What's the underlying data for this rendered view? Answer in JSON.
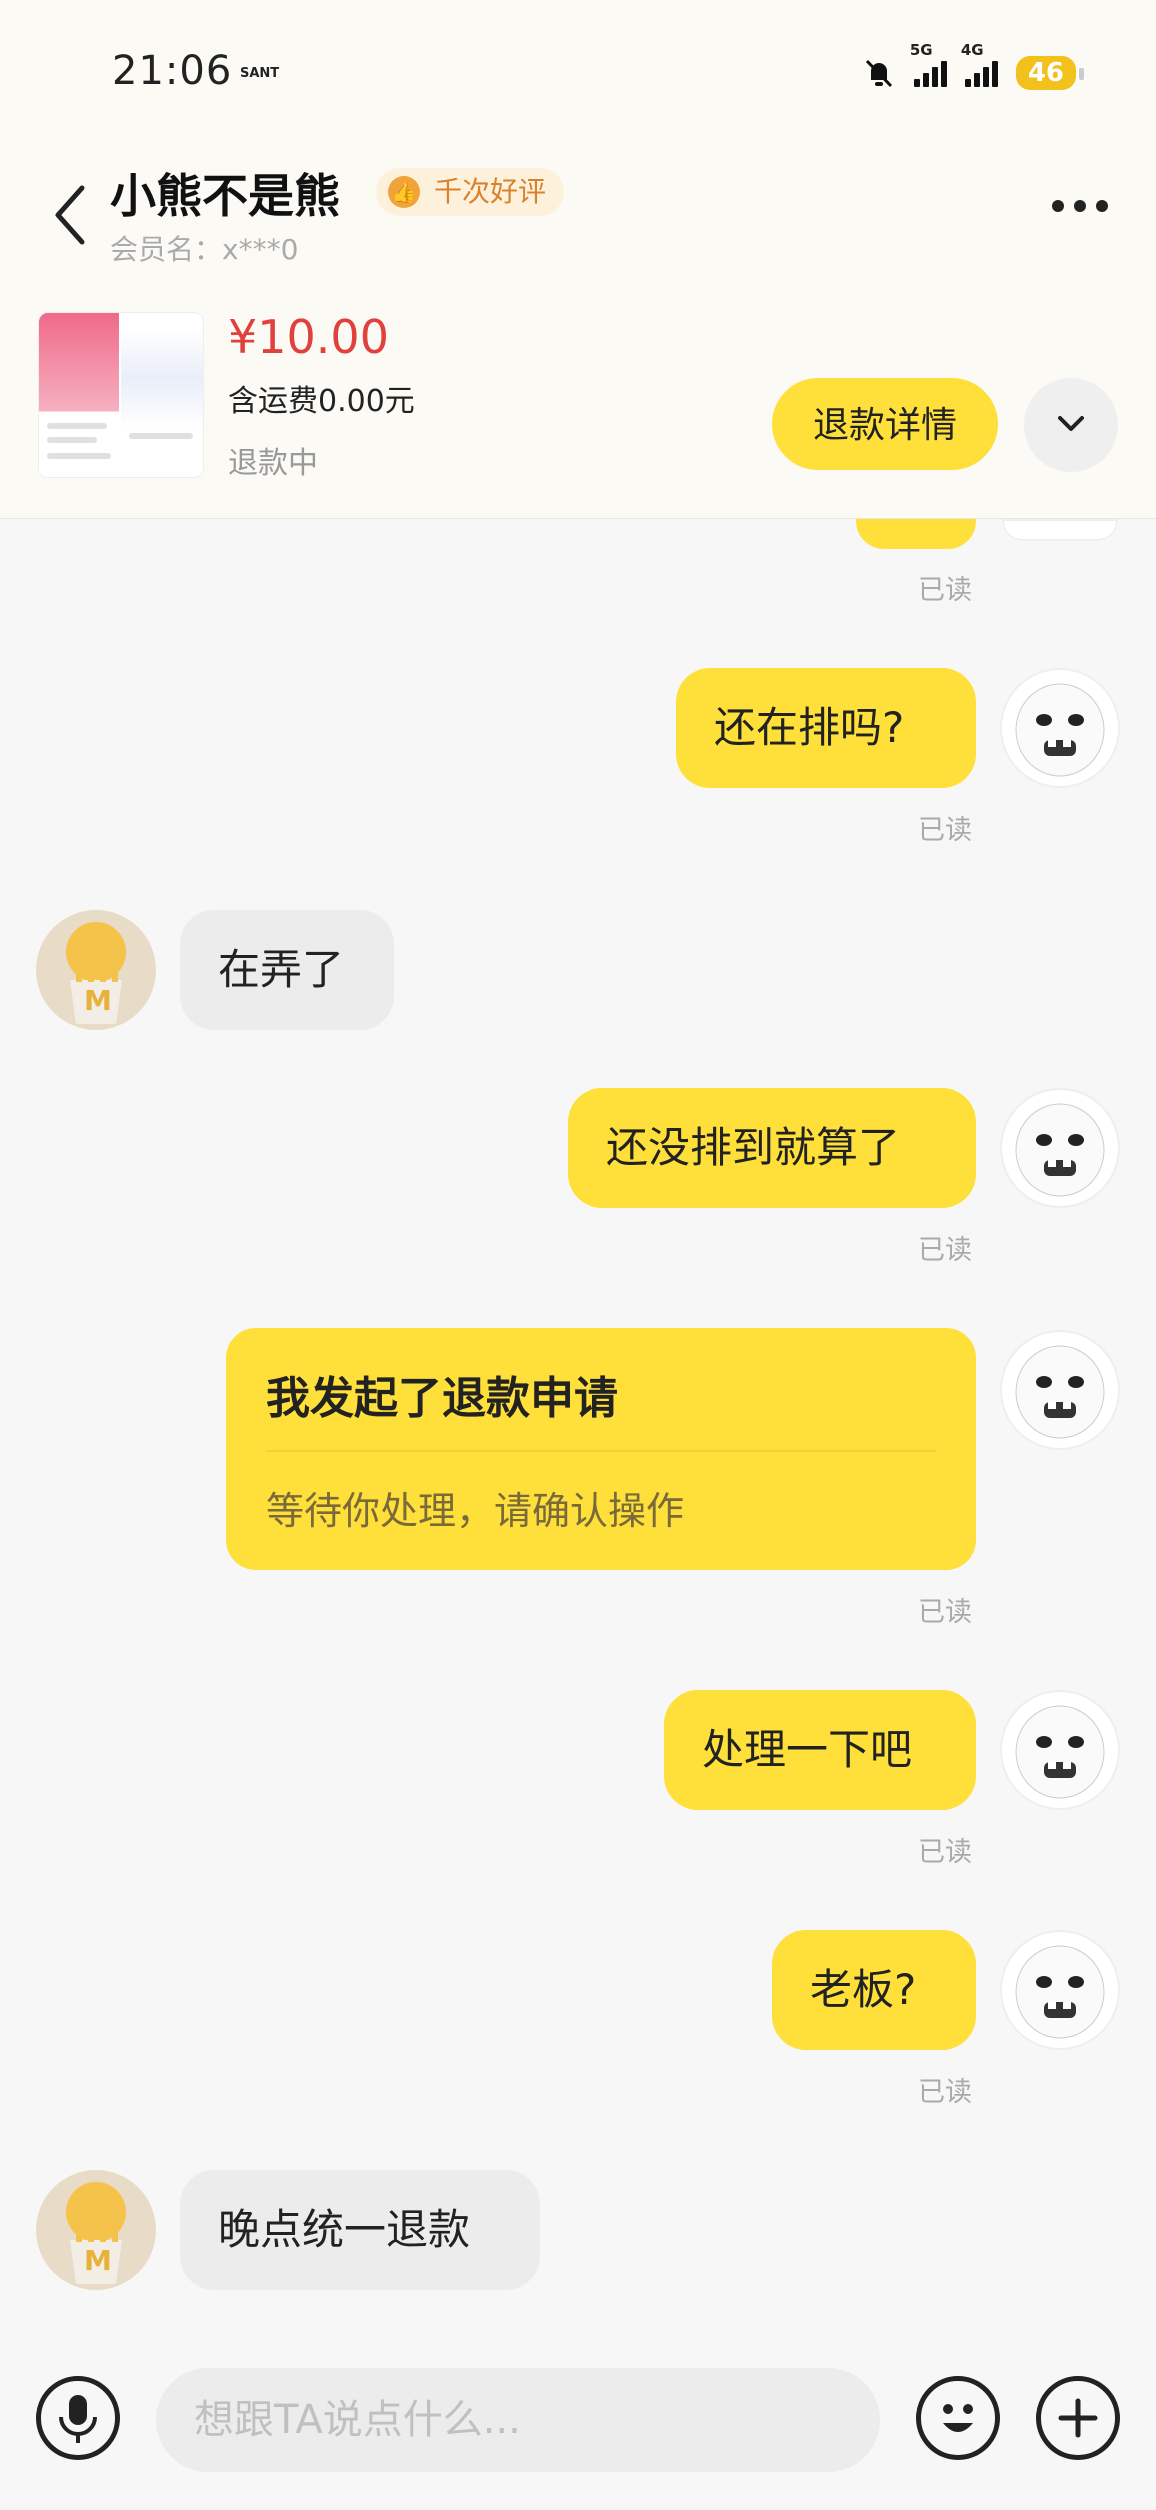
{
  "status_bar": {
    "time": "21:06",
    "carrier_tag": "SANT",
    "network_a": "5G",
    "network_b": "4G",
    "battery": "46"
  },
  "header": {
    "shop_name": "小熊不是熊",
    "badge": "千次好评",
    "member": "会员名：x***0"
  },
  "order": {
    "price": "¥10.00",
    "shipping": "含运费0.00元",
    "status": "退款中",
    "refund_button": "退款详情"
  },
  "messages": [
    {
      "from": "me",
      "text": "还在排吗?",
      "read": "已读"
    },
    {
      "from": "them",
      "text": "在弄了"
    },
    {
      "from": "me",
      "text": "还没排到就算了",
      "read": "已读"
    },
    {
      "from": "me",
      "type": "card",
      "title": "我发起了退款申请",
      "subtitle": "等待你处理，请确认操作",
      "read": "已读"
    },
    {
      "from": "me",
      "text": "处理一下吧",
      "read": "已读"
    },
    {
      "from": "me",
      "text": "老板?",
      "read": "已读"
    },
    {
      "from": "them",
      "text": "晚点统一退款"
    }
  ],
  "top_read": "已读",
  "input": {
    "placeholder": "想跟TA说点什么..."
  },
  "colors": {
    "accent_yellow": "#ffe03a",
    "price_red": "#e0413b",
    "badge_orange": "#d9822b"
  }
}
